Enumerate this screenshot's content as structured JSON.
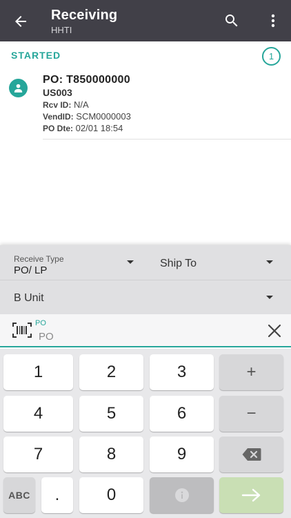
{
  "appbar": {
    "title": "Receiving",
    "subtitle": "HHTI",
    "back_icon": "arrow-left-icon",
    "search_icon": "search-icon",
    "more_icon": "more-vert-icon",
    "background": "#414048"
  },
  "section": {
    "header": "STARTED",
    "count": "1",
    "accent": "#26a69a"
  },
  "items": [
    {
      "po": "PO: T850000000",
      "business_unit": "US003",
      "rcv_id_label": "Rcv ID:",
      "rcv_id": "N/A",
      "vend_id_label": "VendID:",
      "vend_id": "SCM0000003",
      "po_date_label": "PO Dte:",
      "po_date": "02/01 18:54",
      "avatar_icon": "person-icon"
    }
  ],
  "filters": {
    "receive_type_label": "Receive Type",
    "receive_type_value": "PO/ LP",
    "ship_to_label": "Ship To",
    "b_unit_label": "B Unit"
  },
  "scan": {
    "field_label": "PO",
    "placeholder": "PO",
    "barcode_icon": "barcode-scan-icon",
    "clear_icon": "close-icon"
  },
  "keypad": {
    "keys": [
      "1",
      "2",
      "3",
      "4",
      "5",
      "6",
      "7",
      "8",
      "9",
      ".",
      "0"
    ],
    "plus": "+",
    "minus": "−",
    "abc": "ABC",
    "backspace_icon": "backspace-icon",
    "info_icon": "info-icon",
    "enter_icon": "arrow-right-icon"
  }
}
